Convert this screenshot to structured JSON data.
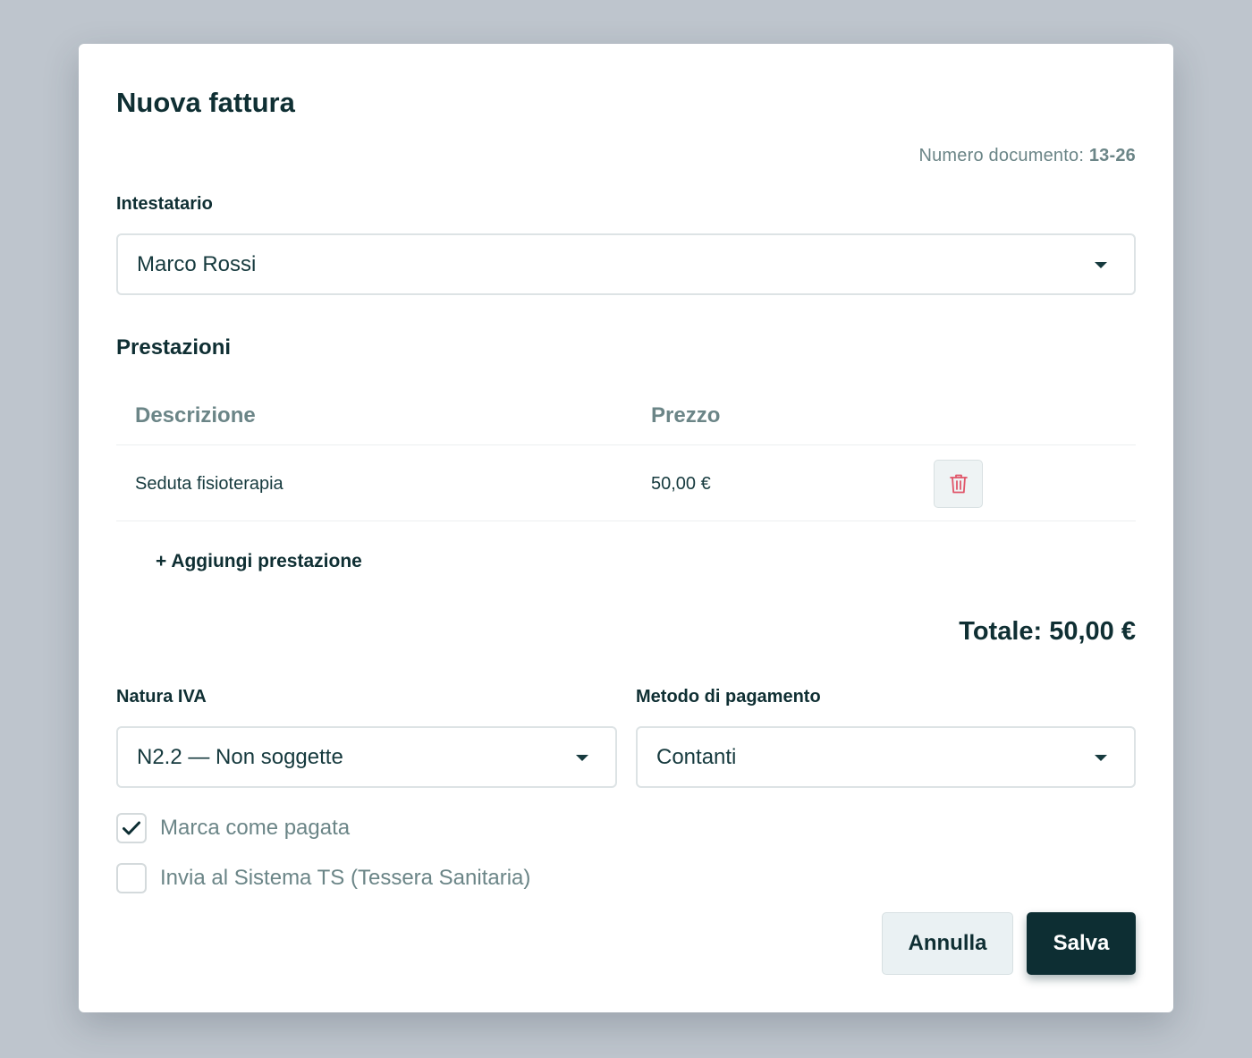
{
  "modal": {
    "title": "Nuova fattura",
    "doc_number_label": "Numero documento:",
    "doc_number": "13-26"
  },
  "intestatario": {
    "label": "Intestatario",
    "value": "Marco Rossi"
  },
  "prestazioni": {
    "title": "Prestazioni",
    "columns": [
      "Descrizione",
      "Prezzo"
    ],
    "rows": [
      {
        "descrizione": "Seduta fisioterapia",
        "prezzo": "50,00 €"
      }
    ],
    "add_label": "+ Aggiungi prestazione"
  },
  "total": "Totale: 50,00 €",
  "natura_iva": {
    "label": "Natura IVA",
    "value": "N2.2 — Non soggette"
  },
  "metodo_pagamento": {
    "label": "Metodo di pagamento",
    "value": "Contanti"
  },
  "checkboxes": [
    {
      "label": "Marca come pagata",
      "checked": true
    },
    {
      "label": "Invia al Sistema TS (Tessera Sanitaria)",
      "checked": false
    }
  ],
  "buttons": {
    "cancel": "Annulla",
    "save": "Salva"
  },
  "icons": {
    "delete": "trash-icon",
    "dropdown": "chevron-down-icon",
    "checked": "check-icon"
  },
  "colors": {
    "primary": "#0d2e33",
    "delete_icon": "#e0566a",
    "muted_text": "#6b8587"
  }
}
